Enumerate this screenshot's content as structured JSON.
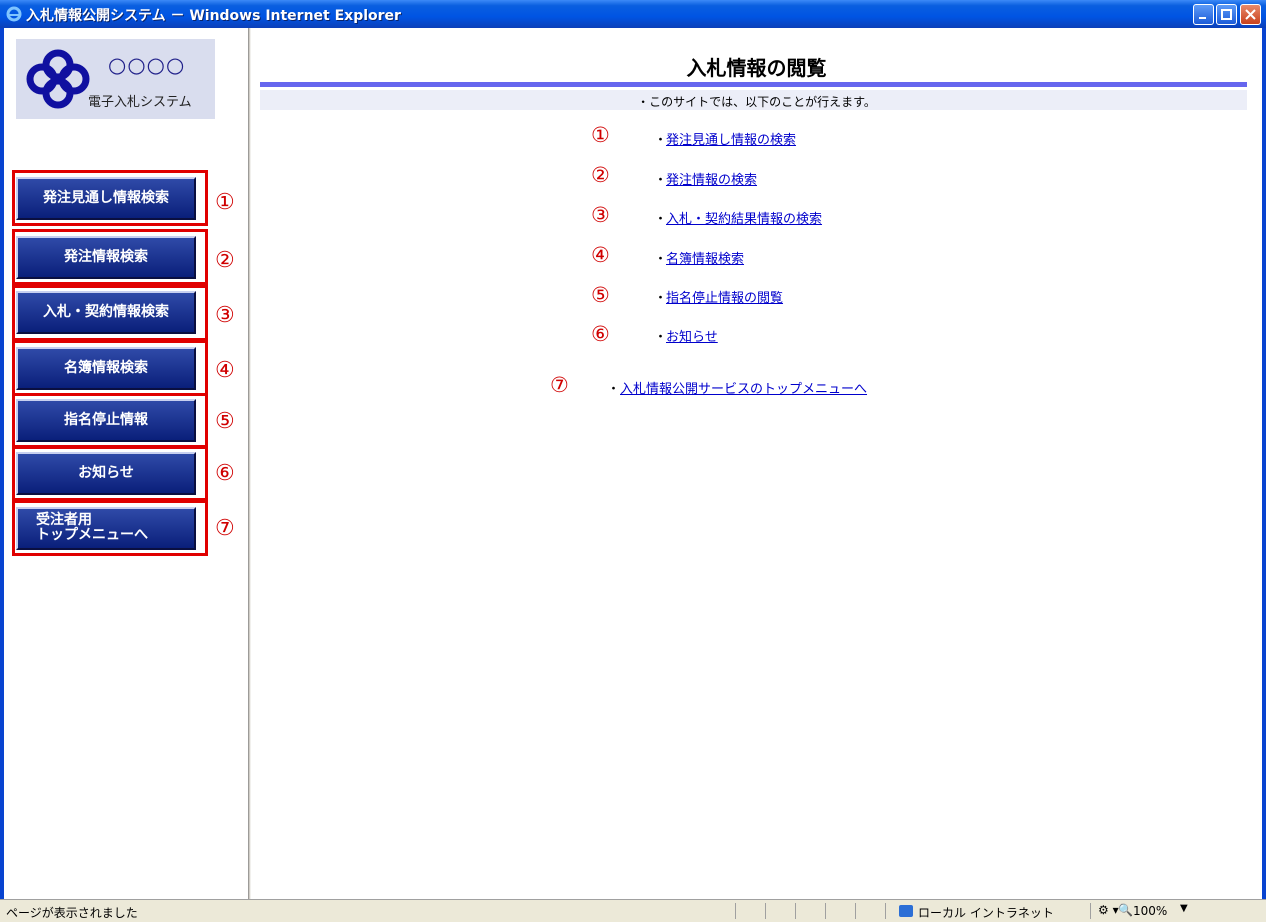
{
  "window": {
    "title": "入札情報公開システム － Windows Internet Explorer"
  },
  "logo": {
    "org": "○○○○",
    "system": "電子入札システム"
  },
  "sidebar": {
    "buttons": [
      {
        "label": "発注見通し情報検索",
        "num": "①"
      },
      {
        "label": "発注情報検索",
        "num": "②"
      },
      {
        "label": "入札・契約情報検索",
        "num": "③"
      },
      {
        "label": "名簿情報検索",
        "num": "④"
      },
      {
        "label": "指名停止情報",
        "num": "⑤"
      },
      {
        "label": "お知らせ",
        "num": "⑥"
      },
      {
        "label_line1": "受注者用",
        "label_line2": "トップメニューへ",
        "num": "⑦"
      }
    ]
  },
  "main": {
    "title": "入札情報の閲覧",
    "intro": "・このサイトでは、以下のことが行えます。",
    "bullet": "・",
    "links": [
      {
        "num": "①",
        "label": "発注見通し情報の検索"
      },
      {
        "num": "②",
        "label": "発注情報の検索"
      },
      {
        "num": "③",
        "label": "入札・契約結果情報の検索"
      },
      {
        "num": "④",
        "label": "名簿情報検索"
      },
      {
        "num": "⑤",
        "label": "指名停止情報の閲覧"
      },
      {
        "num": "⑥",
        "label": "お知らせ"
      },
      {
        "num": "⑦",
        "label": "入札情報公開サービスのトップメニューへ"
      }
    ]
  },
  "statusbar": {
    "status": "ページが表示されました",
    "zone": "ローカル イントラネット",
    "zoom": "100%"
  },
  "colors": {
    "accent": "#6666ee",
    "button": "#0a1f7a",
    "highlight": "#e00000",
    "link": "#0000cc"
  }
}
